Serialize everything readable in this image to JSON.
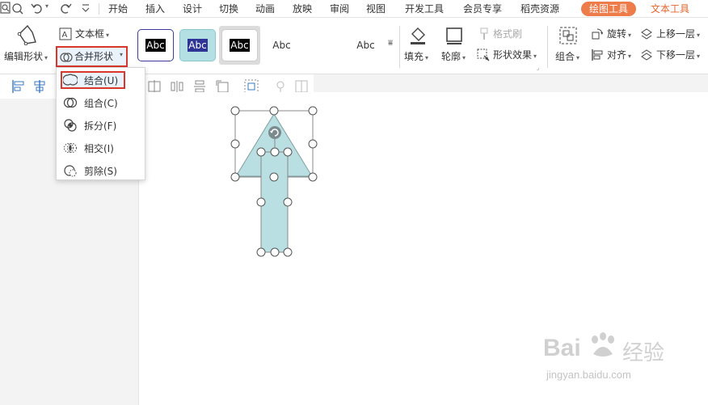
{
  "menubar": {
    "tabs": [
      {
        "label": "开始"
      },
      {
        "label": "插入"
      },
      {
        "label": "设计"
      },
      {
        "label": "切换"
      },
      {
        "label": "动画"
      },
      {
        "label": "放映"
      },
      {
        "label": "审阅"
      },
      {
        "label": "视图"
      },
      {
        "label": "开发工具"
      },
      {
        "label": "会员专享"
      },
      {
        "label": "稻壳资源"
      },
      {
        "label": "绘图工具"
      },
      {
        "label": "文本工具"
      }
    ]
  },
  "ribbon": {
    "edit_shape_label": "编辑形状",
    "textbox_label": "文本框",
    "merge_shape_label": "合并形状",
    "styles": [
      {
        "label": "Abc",
        "bg": "#ffffff",
        "fg": "#333333",
        "border": "#3a3aa0"
      },
      {
        "label": "Abc",
        "bg": "#000000",
        "fg": "#ffffff",
        "border": "#000000"
      },
      {
        "label": "Abc",
        "bg": "#b4dfe3",
        "fg": "#ffffff",
        "border": "#8cc7cc"
      },
      {
        "label": "Abc",
        "bg": "#2f3497",
        "fg": "#ffffff",
        "border": "#2f3497"
      },
      {
        "label": "",
        "bg": "#ffffff",
        "fg": "#333333",
        "border": "#cccccc"
      },
      {
        "label": "Abc",
        "bg": "#000000",
        "fg": "#ffffff",
        "border": "#000000"
      }
    ],
    "fill_label": "填充",
    "outline_label": "轮廓",
    "format_painter_label": "格式刷",
    "shape_effect_label": "形状效果",
    "group_label": "组合",
    "rotate_label": "旋转",
    "align_label": "对齐",
    "bring_forward_label": "上移一层",
    "send_backward_label": "下移一层"
  },
  "dropdown": {
    "items": [
      {
        "label": "结合(U)"
      },
      {
        "label": "组合(C)"
      },
      {
        "label": "拆分(F)"
      },
      {
        "label": "相交(I)"
      },
      {
        "label": "剪除(S)"
      }
    ]
  },
  "watermark": {
    "brand": "Bai",
    "brand2": "经验",
    "url": "jingyan.baidu.com"
  },
  "colors": {
    "accent_tab": "#ee7b4a",
    "highlight_border": "#d9372c",
    "shape_fill": "#b9dfe2",
    "shape_stroke": "#7f9ea0"
  }
}
